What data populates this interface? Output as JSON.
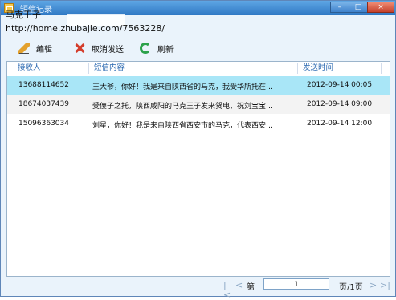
{
  "window": {
    "title": "短信记录",
    "buttons": {
      "minimize": "–",
      "maximize": "□",
      "close": "×"
    }
  },
  "watermark": {
    "line1": "马克王子",
    "line2": "http://home.zhubajie.com/7563228/"
  },
  "toolbar": {
    "edit_label": "编辑",
    "cancel_label": "取消发送",
    "refresh_label": "刷新"
  },
  "table": {
    "headers": [
      "接收人",
      "短信内容",
      "发送时间"
    ],
    "rows": [
      {
        "recipient": "13688114652",
        "content": "王大爷，你好！我是来自陕西省的马克，我受华所托在…",
        "time": "2012-09-14 00:05"
      },
      {
        "recipient": "18674037439",
        "content": "受傻子之托，陕西咸阳的马克王子发来贺电，祝刘宝宝…",
        "time": "2012-09-14 09:00"
      },
      {
        "recipient": "15096363034",
        "content": "刘星，你好！我是来自陕西省西安市的马克，代表西安…",
        "time": "2012-09-14 12:00"
      }
    ]
  },
  "pager": {
    "first_icon": "first-page-icon",
    "prev_icon": "prev-page-icon",
    "next_icon": "next-page-icon",
    "last_icon": "last-page-icon",
    "page_prefix": "第",
    "current_page": "1",
    "page_suffix": "页/1页"
  },
  "colors": {
    "title_bar": "#3f86cf",
    "selected_row": "#a9e6f7",
    "header_text": "#2a68b0"
  }
}
